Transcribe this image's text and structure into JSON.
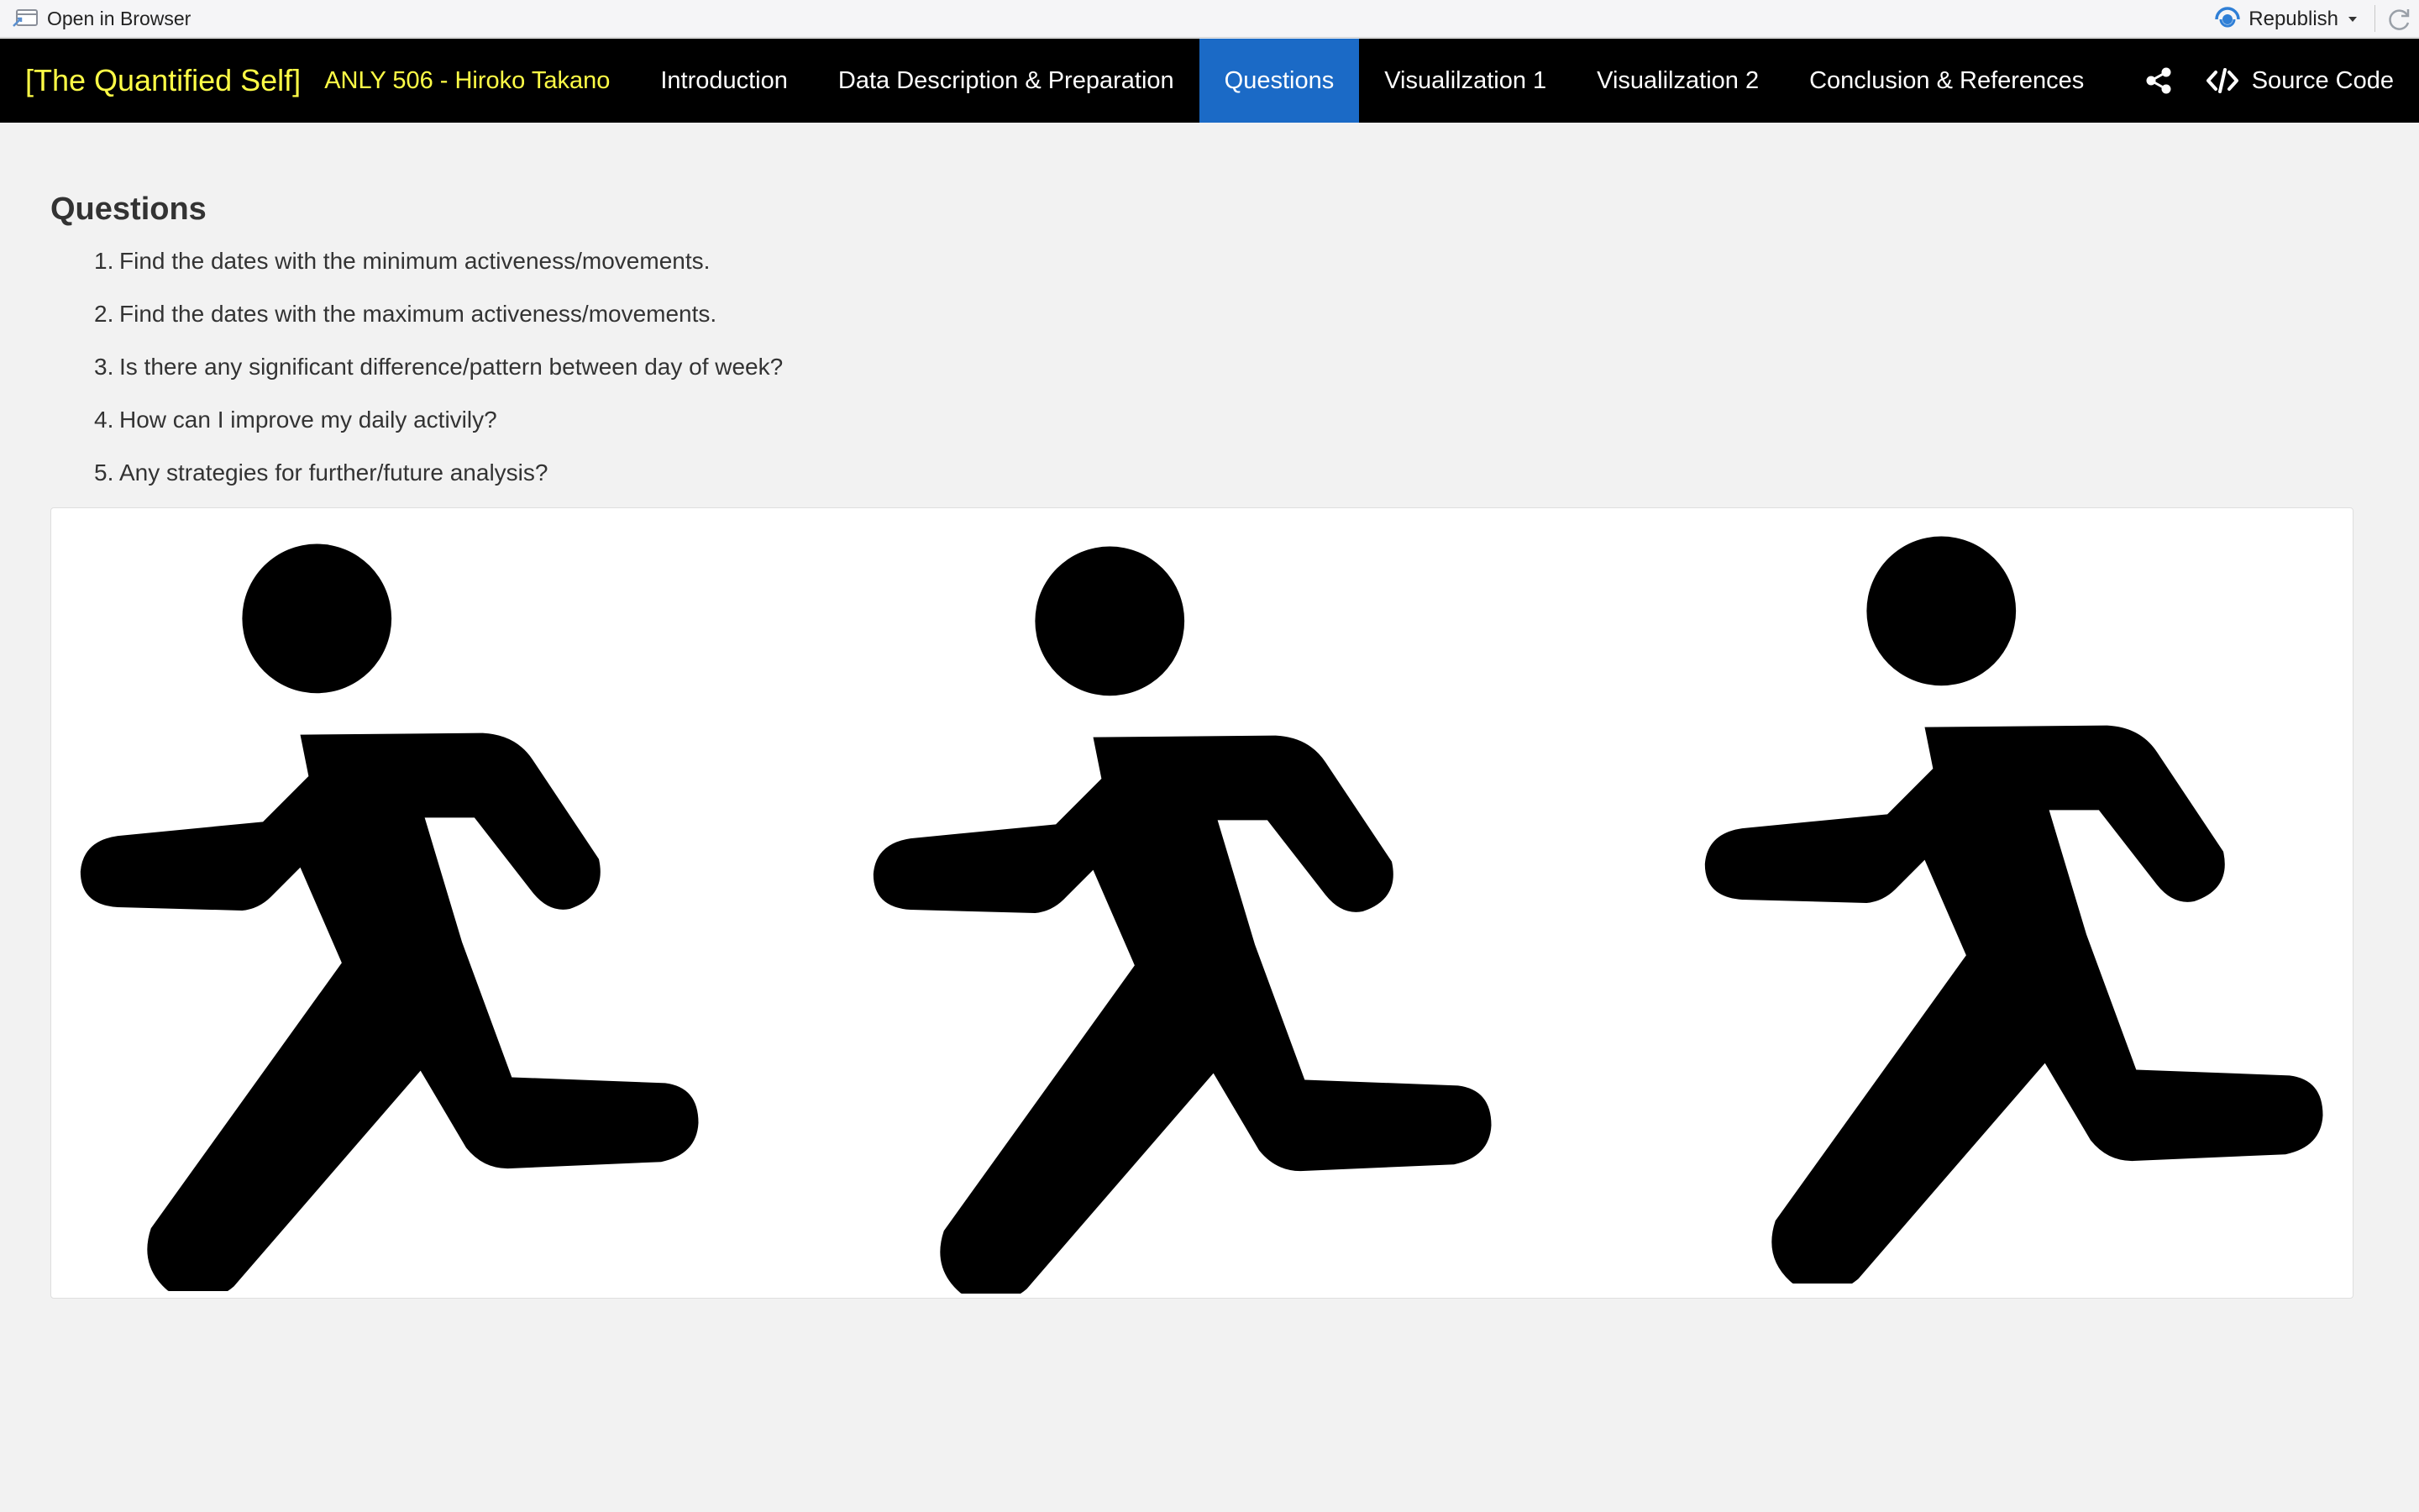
{
  "viewer": {
    "open_browser_label": "Open in Browser",
    "republish_label": "Republish"
  },
  "navbar": {
    "brand": "[The Quantified Self]",
    "author": "ANLY 506 - Hiroko Takano",
    "items": [
      {
        "label": "Introduction"
      },
      {
        "label": "Data Description & Preparation"
      },
      {
        "label": "Questions"
      },
      {
        "label": "Visualilzation 1"
      },
      {
        "label": "Visualilzation 2"
      },
      {
        "label": "Conclusion & References"
      }
    ],
    "active_item": "Questions",
    "source_code_label": "Source Code",
    "colors": {
      "background": "#000000",
      "brand": "#fffd46",
      "active": "#1b6ac6"
    }
  },
  "main": {
    "title": "Questions",
    "questions": [
      {
        "num": "1.",
        "text": "Find the dates with the minimum activeness/movements."
      },
      {
        "num": "2.",
        "text": "Find the dates with the maximum activeness/movements."
      },
      {
        "num": "3.",
        "text": "Is there any significant difference/pattern between day of week?"
      },
      {
        "num": "4.",
        "text": "How can I improve my daily activily?"
      },
      {
        "num": "5.",
        "text": "Any strategies for further/future analysis?"
      }
    ],
    "figure": {
      "icon": "running-person-icon",
      "count": 3
    }
  }
}
